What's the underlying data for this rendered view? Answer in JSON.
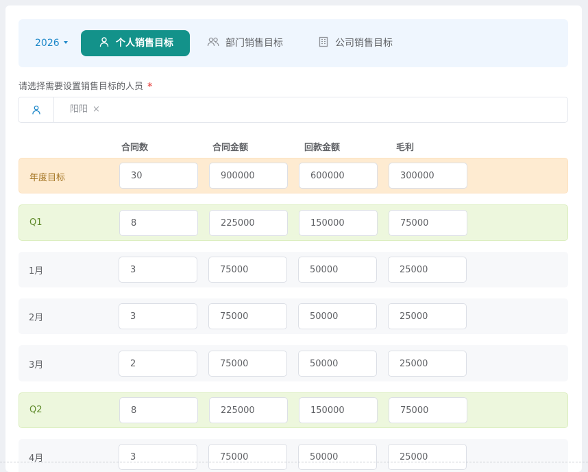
{
  "tabbar": {
    "year": "2026",
    "tabs": [
      {
        "label": "个人销售目标",
        "icon": "user-icon",
        "active": true
      },
      {
        "label": "部门销售目标",
        "icon": "users-icon",
        "active": false
      },
      {
        "label": "公司销售目标",
        "icon": "building-icon",
        "active": false
      }
    ]
  },
  "person_field": {
    "label": "请选择需要设置销售目标的人员",
    "required_mark": "*",
    "selected": "阳阳",
    "remove_glyph": "×"
  },
  "columns": [
    "合同数",
    "合同金额",
    "回款金额",
    "毛利"
  ],
  "rows": [
    {
      "label": "年度目标",
      "kind": "annual",
      "values": [
        "30",
        "900000",
        "600000",
        "300000"
      ]
    },
    {
      "label": "Q1",
      "kind": "quarter",
      "values": [
        "8",
        "225000",
        "150000",
        "75000"
      ]
    },
    {
      "label": "1月",
      "kind": "month",
      "values": [
        "3",
        "75000",
        "50000",
        "25000"
      ]
    },
    {
      "label": "2月",
      "kind": "month",
      "values": [
        "3",
        "75000",
        "50000",
        "25000"
      ]
    },
    {
      "label": "3月",
      "kind": "month",
      "values": [
        "2",
        "75000",
        "50000",
        "25000"
      ]
    },
    {
      "label": "Q2",
      "kind": "quarter",
      "values": [
        "8",
        "225000",
        "150000",
        "75000"
      ]
    },
    {
      "label": "4月",
      "kind": "month",
      "values": [
        "3",
        "75000",
        "50000",
        "25000"
      ]
    }
  ],
  "colors": {
    "accent": "#13928a",
    "link": "#1e88c9",
    "annual_bg": "#feebd1",
    "quarter_bg": "#edf7dd",
    "month_bg": "#f7f8fa",
    "required": "#e53935"
  }
}
